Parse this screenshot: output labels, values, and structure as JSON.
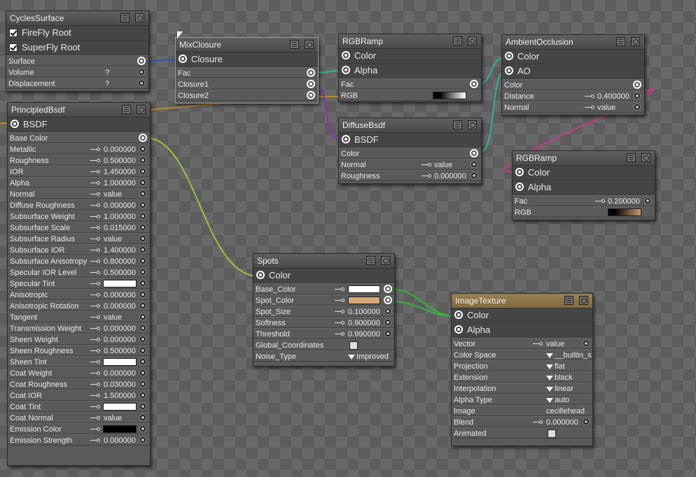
{
  "colors": {
    "wire_blue": "#2f58c8",
    "wire_orange": "#c08a2c",
    "wire_purple": "#8c2fbf",
    "wire_teal": "#27b39b",
    "wire_magenta": "#c83a8c",
    "wire_yellowgreen": "#9cc23a",
    "wire_green": "#2fb83c"
  },
  "nodes": {
    "cycles": {
      "title": "CyclesSurface",
      "checks": [
        "FireFly Root",
        "SuperFly Root"
      ],
      "props": [
        {
          "label": "Surface",
          "value": ""
        },
        {
          "label": "Volume",
          "value": "?"
        },
        {
          "label": "Displacement",
          "value": "?"
        }
      ]
    },
    "principled": {
      "title": "PrincipledBsdf",
      "output": "BSDF",
      "props": [
        {
          "label": "Base Color",
          "value": ""
        },
        {
          "label": "Metallic",
          "value": "0.000000"
        },
        {
          "label": "Roughness",
          "value": "0.500000"
        },
        {
          "label": "IOR",
          "value": "1.450000"
        },
        {
          "label": "Alpha",
          "value": "1.000000"
        },
        {
          "label": "Normal",
          "value": "value"
        },
        {
          "label": "Diffuse Roughness",
          "value": "0.000000"
        },
        {
          "label": "Subsurface Weight",
          "value": "1.000000"
        },
        {
          "label": "Subsurface Scale",
          "value": "0.015000"
        },
        {
          "label": "Subsurface Radius",
          "value": "value"
        },
        {
          "label": "Subsurface IOR",
          "value": "1.400000"
        },
        {
          "label": "Subsurface Anisotropy",
          "value": "0.800000"
        },
        {
          "label": "Specular IOR Level",
          "value": "0.500000"
        },
        {
          "label": "Specular Tint",
          "value": ""
        },
        {
          "label": "Anisotropic",
          "value": "0.000000"
        },
        {
          "label": "Anisotropic Rotation",
          "value": "0.000000"
        },
        {
          "label": "Tangent",
          "value": "value"
        },
        {
          "label": "Transmission Weight",
          "value": "0.000000"
        },
        {
          "label": "Sheen Weight",
          "value": "0.000000"
        },
        {
          "label": "Sheen Roughness",
          "value": "0.500000"
        },
        {
          "label": "Sheen Tint",
          "value": ""
        },
        {
          "label": "Coat Weight",
          "value": "0.000000"
        },
        {
          "label": "Coat Roughness",
          "value": "0.030000"
        },
        {
          "label": "Coat IOR",
          "value": "1.500000"
        },
        {
          "label": "Coat Tint",
          "value": ""
        },
        {
          "label": "Coat Normal",
          "value": "value"
        },
        {
          "label": "Emission Color",
          "value": ""
        },
        {
          "label": "Emission Strength",
          "value": "0.000000"
        }
      ]
    },
    "mix": {
      "title": "MixClosure",
      "output": "Closure",
      "props": [
        {
          "label": "Fac",
          "value": ""
        },
        {
          "label": "Closure1",
          "value": ""
        },
        {
          "label": "Closure2",
          "value": ""
        }
      ]
    },
    "ramp1": {
      "title": "RGBRamp",
      "outputs": [
        "Color",
        "Alpha"
      ],
      "props": [
        {
          "label": "Fac",
          "value": ""
        },
        {
          "label": "RGB",
          "value": ""
        }
      ]
    },
    "diffuse": {
      "title": "DiffuseBsdf",
      "output": "BSDF",
      "props": [
        {
          "label": "Color",
          "value": ""
        },
        {
          "label": "Normal",
          "value": "value"
        },
        {
          "label": "Roughness",
          "value": "0.000000"
        }
      ]
    },
    "ao": {
      "title": "AmbientOcclusion",
      "outputs": [
        "Color",
        "AO"
      ],
      "props": [
        {
          "label": "Color",
          "value": ""
        },
        {
          "label": "Distance",
          "value": "0.400000"
        },
        {
          "label": "Normal",
          "value": "value"
        }
      ]
    },
    "ramp2": {
      "title": "RGBRamp",
      "outputs": [
        "Color",
        "Alpha"
      ],
      "props": [
        {
          "label": "Fac",
          "value": "0.200000"
        },
        {
          "label": "RGB",
          "value": ""
        }
      ]
    },
    "spots": {
      "title": "Spots",
      "output": "Color",
      "props": [
        {
          "label": "Base_Color",
          "value": ""
        },
        {
          "label": "Spot_Color",
          "value": ""
        },
        {
          "label": "Spot_Size",
          "value": "0.100000"
        },
        {
          "label": "Softness",
          "value": "0.900000"
        },
        {
          "label": "Threshold",
          "value": "0.990000"
        },
        {
          "label": "Global_Coordinates",
          "value": ""
        },
        {
          "label": "Noise_Type",
          "value": "Improved"
        }
      ]
    },
    "image": {
      "title": "ImageTexture",
      "outputs": [
        "Color",
        "Alpha"
      ],
      "props": [
        {
          "label": "Vector",
          "value": "value"
        },
        {
          "label": "Color Space",
          "value": "__builtin_s"
        },
        {
          "label": "Projection",
          "value": "flat"
        },
        {
          "label": "Extension",
          "value": "black"
        },
        {
          "label": "Interpolation",
          "value": "linear"
        },
        {
          "label": "Alpha Type",
          "value": "auto"
        },
        {
          "label": "Image",
          "value": "cecillehead"
        },
        {
          "label": "Blend",
          "value": "0.000000"
        },
        {
          "label": "Animated",
          "value": ""
        }
      ]
    }
  }
}
